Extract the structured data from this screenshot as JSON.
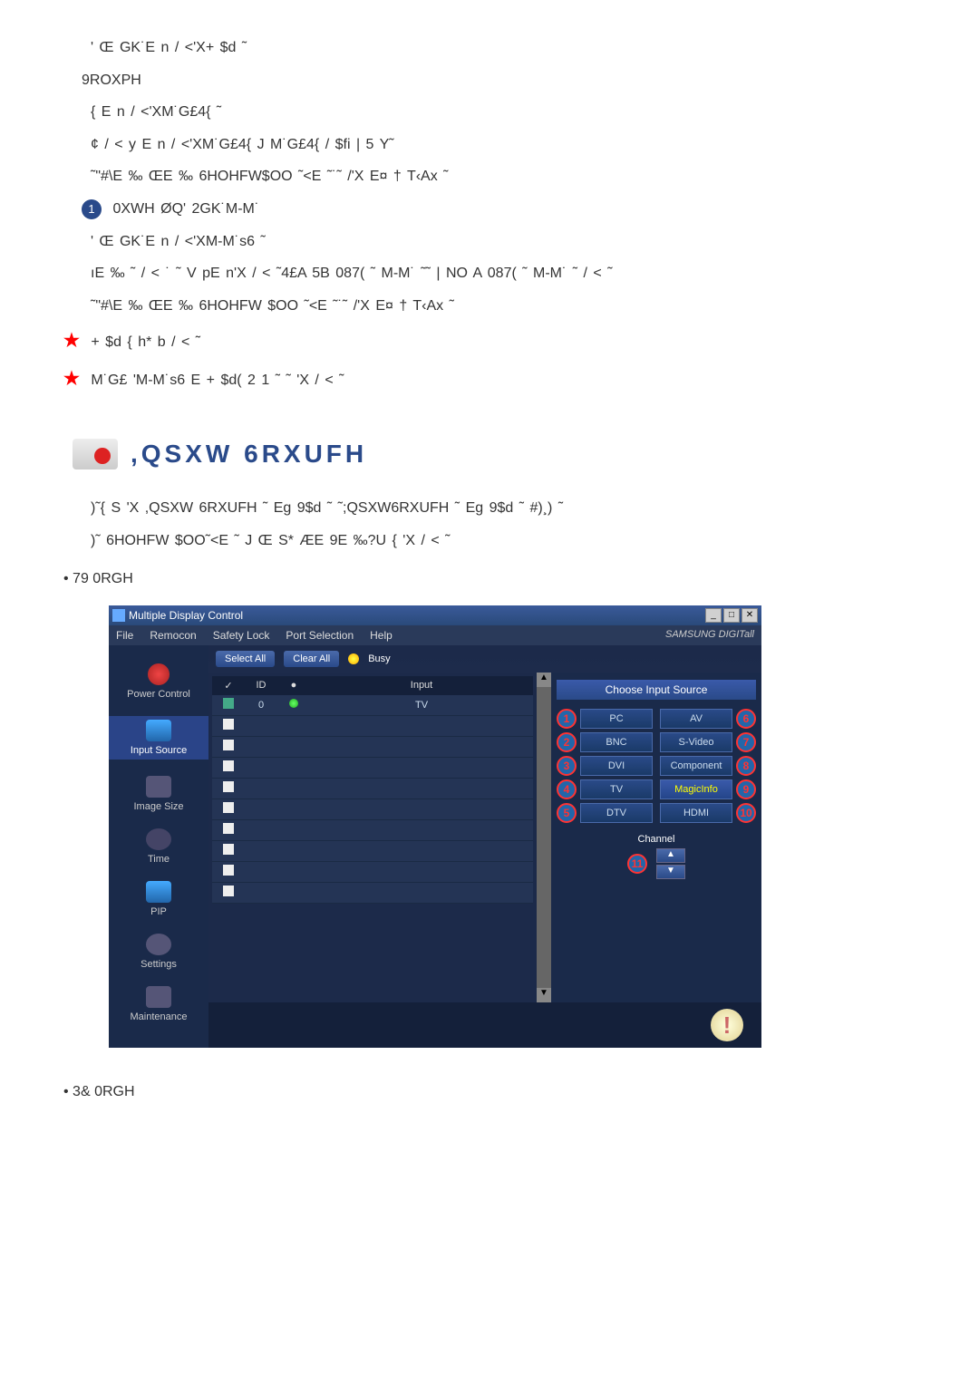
{
  "upper": {
    "line1": "' Œ GK˙E  n  / <'X+ $d ˜",
    "vol_label": "9ROXPH",
    "vol1": "{  E  n  / <'XM˙G£4{  ˜",
    "vol2": "¢ / < y  E  n  / <'XM˙G£4{  J M˙G£4{  /  $fi | 5 Y˜",
    "vol3": "˜\"#\\E  ‰ ŒE  ‰   6HOHFW$OO ˜<E ˜˙˜ /'X E¤ † T‹Ax         ˜",
    "mute_label": "0XWH  ØQ' 2GK˙M-M˙",
    "mute1": "' Œ GK˙E  n  / <'XM-M˙s6 ˜",
    "mute2": "ıE  ‰  ˜ / < ˙  ˜  V pE n'X / < ˜4£A 5B   087( ˜ M-M˙ ˜˜  | NO A  087( ˜ M-M˙ ˜  / < ˜",
    "mute3": "˜\"#\\E  ‰ ŒE  ‰   6HOHFW $OO ˜<E ˜˙˜ /'X E¤ † T‹Ax  ˜",
    "star1": "+ $d {  h* b    / < ˜",
    "star2": "M˙G£ 'M-M˙s6  E  + $d(     2 1  ˜    ˜ 'X / < ˜"
  },
  "section": {
    "title": ",QSXW 6RXUFH",
    "desc1": ")˜{  S 'X  ,QSXW 6RXUFH ˜ Eg 9$d ˜ ˜;QSXW6RXUFH ˜ Eg 9$d ˜ #)¸) ˜",
    "desc2": ")˜ 6HOHFW $OO˜<E ˜ J Œ S* ÆE  9E ‰?U { 'X / < ˜",
    "mode_tv": "• 79 0RGH",
    "mode_pc": "• 3& 0RGH"
  },
  "app": {
    "title": "Multiple Display Control",
    "menu": [
      "File",
      "Remocon",
      "Safety Lock",
      "Port Selection",
      "Help"
    ],
    "brand": "SAMSUNG DIGITall",
    "toolbar": {
      "select_all": "Select All",
      "clear_all": "Clear All",
      "busy": "Busy"
    },
    "sidebar": {
      "power": "Power Control",
      "input": "Input Source",
      "image": "Image Size",
      "time": "Time",
      "pip": "PIP",
      "settings": "Settings",
      "maintenance": "Maintenance"
    },
    "list": {
      "col_chk": "✓",
      "col_id": "ID",
      "col_dot": "●",
      "col_input": "Input",
      "row0_id": "0",
      "row0_val": "TV"
    },
    "panel": {
      "title": "Choose Input Source",
      "pc": "PC",
      "bnc": "BNC",
      "dvi": "DVI",
      "tv": "TV",
      "dtv": "DTV",
      "av": "AV",
      "svideo": "S-Video",
      "component": "Component",
      "magicinfo": "MagicInfo",
      "hdmi": "HDMI",
      "channel_label": "Channel",
      "callouts": {
        "c1": "1",
        "c2": "2",
        "c3": "3",
        "c4": "4",
        "c5": "5",
        "c6": "6",
        "c7": "7",
        "c8": "8",
        "c9": "9",
        "c10": "10",
        "c11": "11"
      }
    },
    "winbtn": {
      "min": "_",
      "max": "□",
      "close": "✕"
    }
  }
}
